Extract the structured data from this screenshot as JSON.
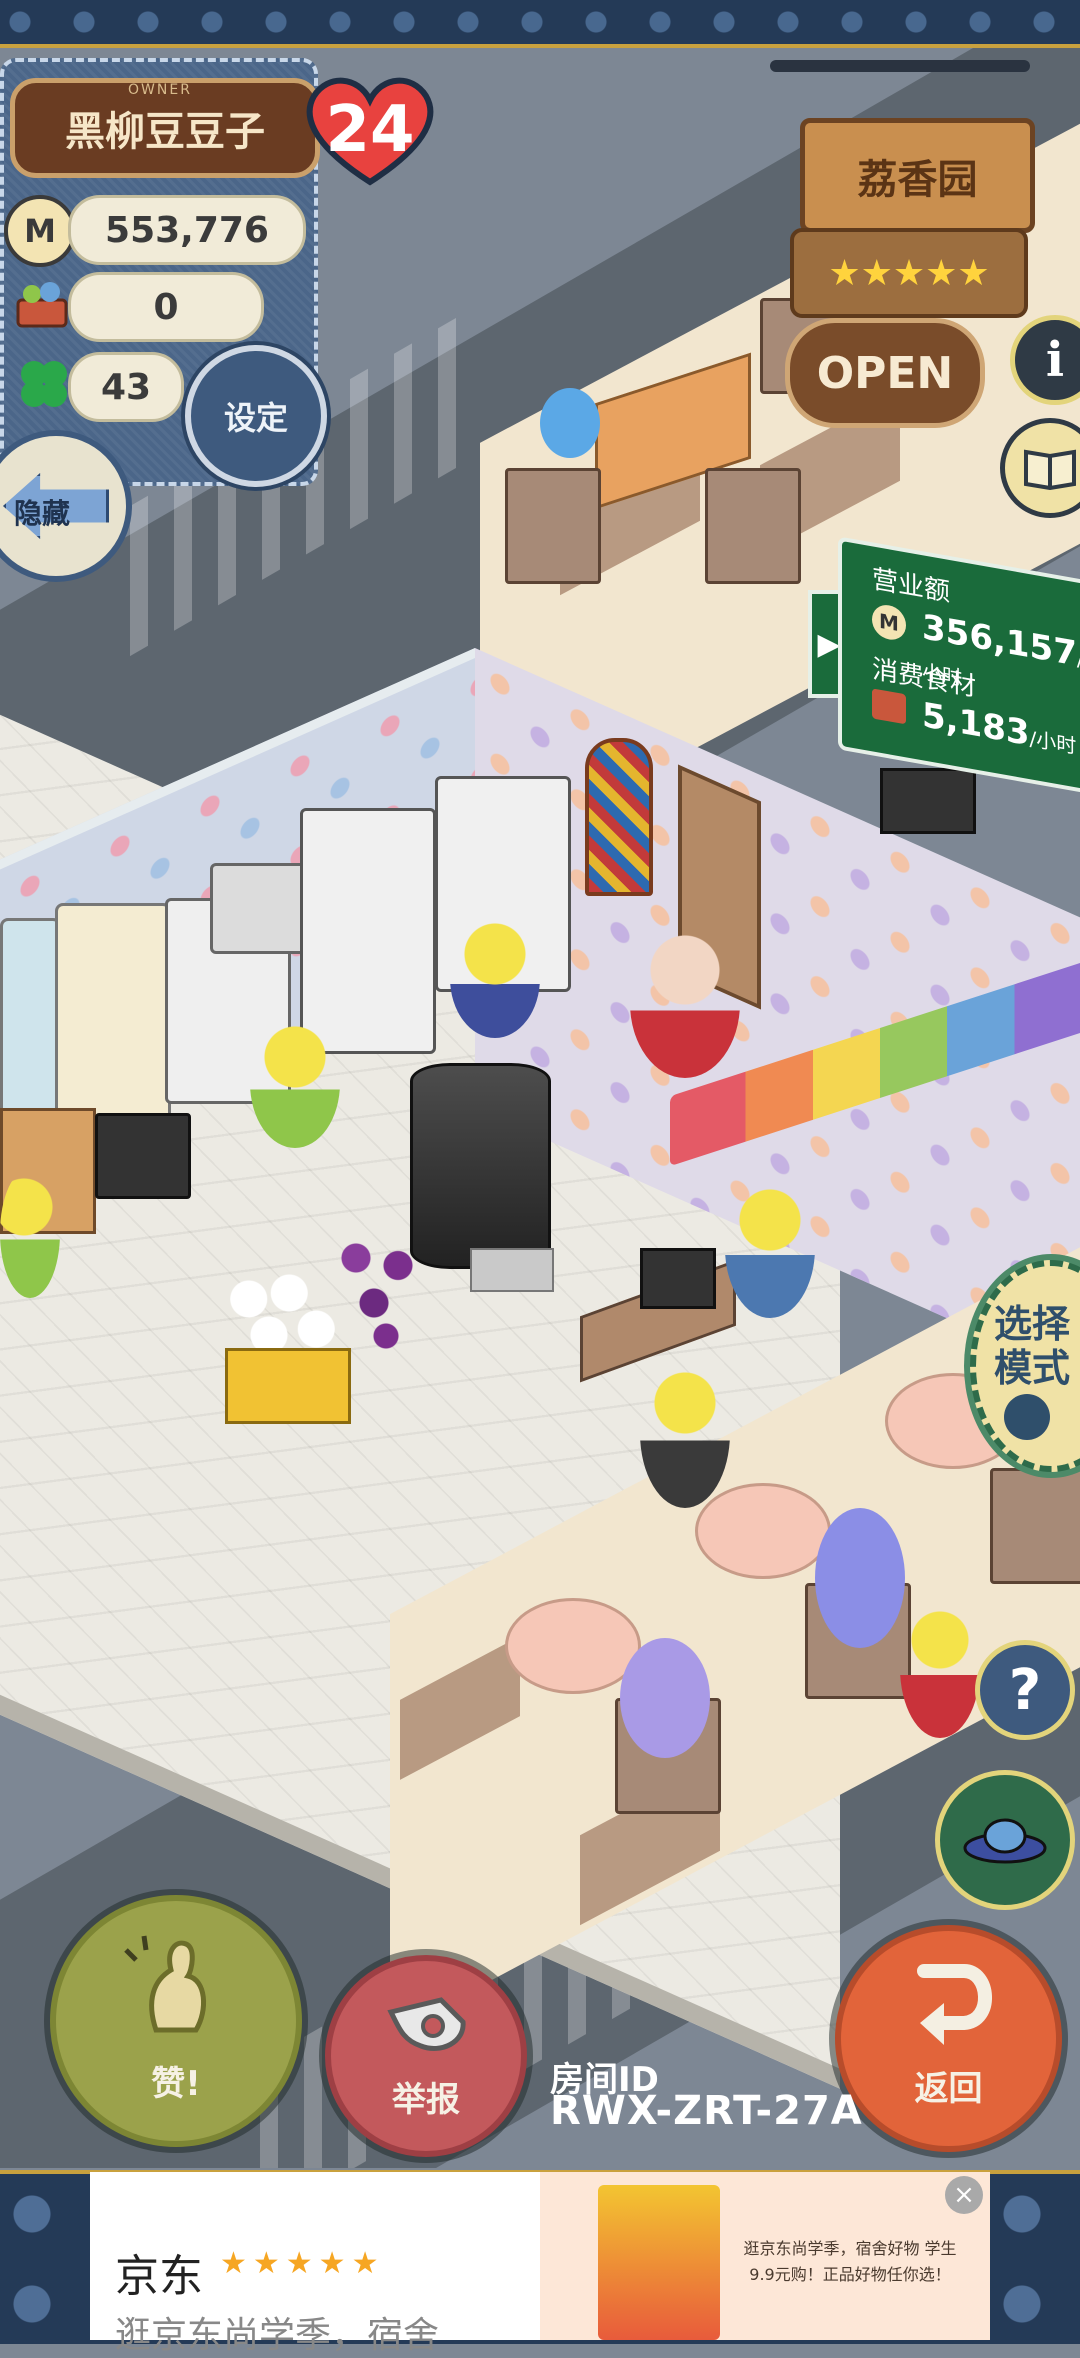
{
  "owner": {
    "caption": "OWNER",
    "name": "黑柳豆豆子",
    "likes": "24",
    "coins": "553,776",
    "coin_symbol": "M",
    "ingredients": "0",
    "clovers": "43"
  },
  "buttons": {
    "settings": "设定",
    "hide": "隐藏",
    "mode": "选择模式",
    "mode_line1": "选择",
    "mode_line2": "模式",
    "like": "赞!",
    "report": "举报",
    "back": "返回",
    "info": "i",
    "help": "?"
  },
  "shop": {
    "name": "荔香园",
    "stars": 5,
    "star_glyphs": "★★★★★",
    "status": "OPEN"
  },
  "revenue": {
    "revenue_label": "营业额",
    "revenue_value": "356,157",
    "revenue_unit": "/小时",
    "food_label": "消费食材",
    "food_value": "5,183",
    "food_unit": "/小时"
  },
  "room": {
    "id_label": "房间ID",
    "id_value": "RWX-ZRT-27A"
  },
  "ad": {
    "brand": "京东",
    "stars": "★★★★★",
    "subtitle": "逛京东尚学季，宿舍",
    "text": "逛京东尚学季，宿舍好物 学生9.9元购！正品好物任你选！",
    "close": "×"
  },
  "colors": {
    "panel_blue": "#4b6689",
    "heart_red": "#e8423f",
    "like_green": "#9ba24b",
    "report_red": "#c3595c",
    "back_orange": "#e2643a",
    "board_green": "#1a6b3b"
  }
}
